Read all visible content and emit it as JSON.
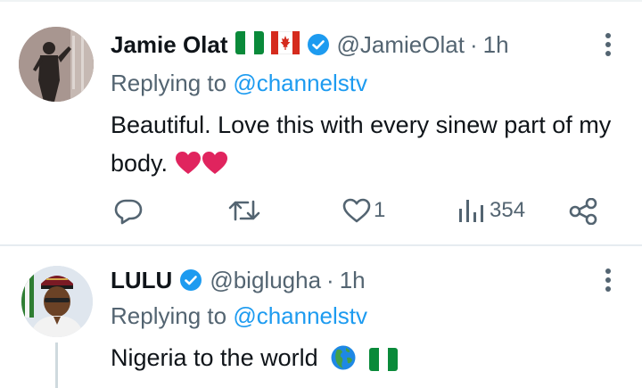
{
  "tweets": [
    {
      "name": "Jamie Olat",
      "handle": "@JamieOlat",
      "separator": "·",
      "time": "1h",
      "reply_prefix": "Replying to",
      "reply_to": "@channelstv",
      "text": "Beautiful. Love this with every sinew part of my body.",
      "emoji": [
        "heart",
        "heart"
      ],
      "flags": [
        "nigeria-flag",
        "canada-flag"
      ],
      "stats": {
        "replies": "",
        "retweets": "",
        "likes": "1",
        "views": "354"
      }
    },
    {
      "name": "LULU",
      "handle": "@biglugha",
      "separator": "·",
      "time": "1h",
      "reply_prefix": "Replying to",
      "reply_to": "@channelstv",
      "text": "Nigeria to the world",
      "emoji": [
        "globe-americas",
        "nigeria-flag"
      ]
    }
  ],
  "colors": {
    "text": "#0f1419",
    "secondary": "#536471",
    "link": "#1d9bf0",
    "verified": "#1d9bf0",
    "heart": "#e0245e",
    "divider": "#e6ecf0"
  }
}
